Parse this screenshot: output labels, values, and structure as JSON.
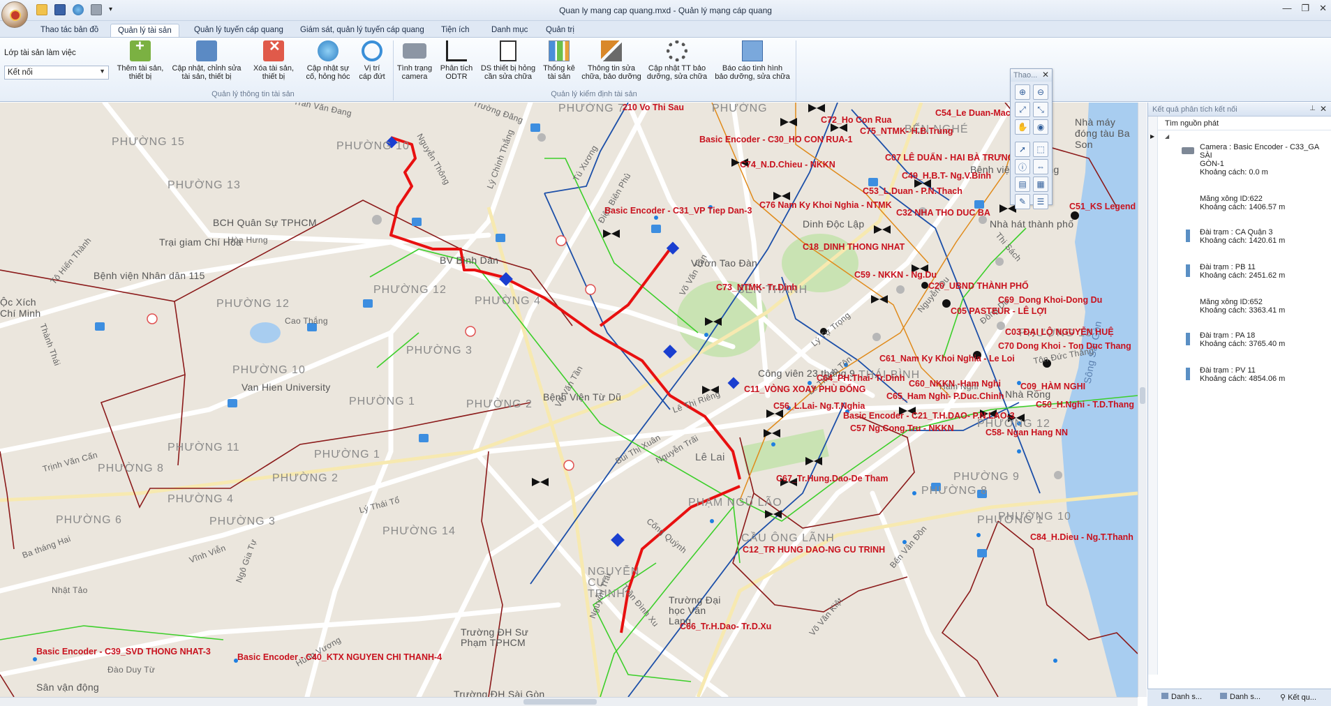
{
  "window": {
    "title": "Quan ly mang cap quang.mxd - Quản lý mạng cáp quang"
  },
  "tabs": [
    {
      "label": "Thao tác bản đồ",
      "active": false
    },
    {
      "label": "Quản lý tài sản",
      "active": true
    },
    {
      "label": "Quản lý tuyến cáp quang",
      "active": false
    },
    {
      "label": "Giám sát, quản lý tuyến cáp quang",
      "active": false
    },
    {
      "label": "Tiện ích",
      "active": false
    },
    {
      "label": "Danh mục",
      "active": false
    },
    {
      "label": "Quản trị",
      "active": false
    }
  ],
  "ribbon": {
    "layer_label": "Lớp tài sản làm việc",
    "layer_value": "Kết nối",
    "group1_label": "Quản lý thông tin tài sản",
    "group2_label": "Quản lý kiểm định tài sản",
    "buttons": [
      {
        "line1": "Thêm tài sản,",
        "line2": "thiết bị"
      },
      {
        "line1": "Cập nhật, chỉnh sửa",
        "line2": "tài sản, thiết bị"
      },
      {
        "line1": "Xóa tài sản,",
        "line2": "thiết bị"
      },
      {
        "line1": "Cập nhật sự",
        "line2": "cố, hỏng hóc"
      },
      {
        "line1": "Vị trí",
        "line2": "cáp đứt"
      },
      {
        "line1": "Tình trạng",
        "line2": "camera"
      },
      {
        "line1": "Phân tích",
        "line2": "ODTR"
      },
      {
        "line1": "DS thiết bị hỏng",
        "line2": "cần sửa chữa"
      },
      {
        "line1": "Thống kê",
        "line2": "tài sản"
      },
      {
        "line1": "Thông tin sửa",
        "line2": "chữa, bảo dưỡng"
      },
      {
        "line1": "Cập nhật TT bảo",
        "line2": "dưỡng, sửa chữa"
      },
      {
        "line1": "Báo cáo tình hình",
        "line2": "bảo dưỡng, sửa chữa"
      }
    ]
  },
  "float_toolbar": {
    "title": "Thao..."
  },
  "map": {
    "district_labels": [
      "PHƯỜNG 15",
      "PHƯỜNG 10",
      "PHƯỜNG 13",
      "PHƯỜNG 7",
      "PHƯỜNG 12",
      "PHƯỜNG 12",
      "PHƯỜNG 4",
      "PHƯỜNG 3",
      "PHƯỜNG 10",
      "PHƯỜNG 1",
      "PHƯỜNG 2",
      "PHƯỜNG 1",
      "PHƯỜNG 11",
      "PHƯỜNG 8",
      "PHƯỜNG 2",
      "PHƯỜNG 4",
      "PHƯỜNG 6",
      "PHƯỜNG 3",
      "PHƯỜNG 14",
      "PHƯỜNG 10",
      "PHƯỜNG 9",
      "PHƯỜNG 8",
      "PHƯỜNG 12",
      "PHƯỜNG 13",
      "PHƯỜNG 1",
      "BẾN THÀNH",
      "PHẠM NGŨ LÃO",
      "CẦU ÔNG LÃNH",
      "NGUYỄN CƯ TRINH",
      "THÁI BÌNH",
      "BẾN NGHÉ",
      "PHƯỜNG"
    ],
    "place_labels": [
      "BCH Quân Sự TPHCM",
      "Trại giam Chí Hòa",
      "Bệnh viện Nhân dân 115",
      "BV Bình Dân",
      "Van Hien University",
      "Vườn Tao Đàn",
      "Dinh Độc Lập",
      "Công viên 23 tháng 9",
      "Trường Đại học Văn Lang",
      "Trường ĐH Sư Phạm TPHCM",
      "Sân vận động",
      "Bệnh Viện Từ Dũ",
      "Nhà hát thành phố",
      "Nhà Rồng",
      "Nhà máy đóng tàu Ba Son",
      "Bệnh viện Nhi đồng",
      "Ộc Xích Chí Minh",
      "Trường ĐH Sài Gòn"
    ],
    "road_labels": [
      "Trần Văn Đang",
      "Trường Đăng",
      "Nguyễn Thông",
      "Lý Chính Thắng",
      "Tú Xương",
      "Điện Biên Phủ",
      "Võ Văn Tần",
      "Cao Thắng",
      "Hòa Hưng",
      "Tô Hiến Thành",
      "Thành Thái",
      "Lý Thái Tổ",
      "Ba tháng Hai",
      "Ngô Gia Tự",
      "Vĩnh Viễn",
      "Nhật Tảo",
      "Hùng Vương",
      "Đào Duy Từ",
      "Võ Văn Tần",
      "Bùi Thị Xuân",
      "Nguyễn Trãi",
      "Lê Lai",
      "Lê Thị Riêng",
      "Cống Quỳnh",
      "Trần Đình Xu",
      "Võ Văn Kiệt",
      "Bến Vân Đồn",
      "Tôn Đức Thắng",
      "Lý Tự Trọng",
      "Nguyễn Du",
      "Lê Thánh Tôn",
      "Thi Sách",
      "Sông Sài Gòn",
      "Đông Du",
      "Hàm Nghi",
      "Trịnh Văn Cấn",
      "Nguyễn Trãi"
    ],
    "red_labels": [
      "210 Vo Thi Sau",
      "C72_Ho Con Rua",
      "C54_Le Duan-Mac",
      "Basic Encoder - C30_HO CON RUA-1",
      "C75_NTMK- H.B.Trung",
      "C07 LÊ DUẨN - HAI BÀ TRƯNG",
      "C74_N.D.Chieu - NKKN",
      "C49_H.B.T- Ng.V.Binh",
      "C53_L.Duan - P.N.Thach",
      "C51_KS Legend",
      "Basic Encoder - C31_VP Tiep Dan-3",
      "C76 Nam Ky Khoi Nghia - NTMK",
      "C32 NHA THO DUC BA",
      "C18_DINH THONG NHAT",
      "C59 - NKKN - Ng.Du",
      "C20_UBND THÀNH PHỐ",
      "C73_NTMK- Tr.Dinh",
      "C69_Dong Khoi-Dong Du",
      "C05 PASTEUR - LÊ LỢI",
      "C03 ĐẠI LỘ NGUYỄN HUỆ",
      "C70 Dong Khoi - Ton Duc Thang",
      "C61_Nam Ky Khoi Nghia - Le Loi",
      "C64_PH.Thai- Tr.Dinh",
      "C60_NKKN -Ham Nghi",
      "C09_HÀM NGHI",
      "C11_VÒNG XOAY PHÙ ĐỔNG",
      "C65_Ham Nghi- P.Duc.Chinh",
      "C50_H.Nghi - T.D.Thang",
      "C56_L.Lai- Ng.T.Nghia",
      "Basic Encoder - C21_T.H.DAO- P.N.LAO-3",
      "C57 Ng.Cong.Tru - NKKN",
      "C58- Ngan Hang NN",
      "C67_Tr.Hung.Dao-De Tham",
      "C12_TR HUNG DAO-NG CU TRINH",
      "C84_H.Dieu - Ng.T.Thanh",
      "C66_Tr.H.Dao- Tr.D.Xu",
      "Basic Encoder - C39_SVD THONG NHAT-3",
      "Basic Encoder - C40_KTX NGUYEN CHI THANH-4"
    ]
  },
  "right_panel": {
    "title": "Kết quả phân tích kết nối",
    "subheader": "Tìm nguồn phát",
    "results": [
      {
        "name": "Camera : Basic Encoder - C33_GA SÀI",
        "name2": "GÒN-1",
        "distance": "Khoảng cách: 0.0 m",
        "icon": "camera-icon"
      },
      {
        "name": "Măng xông  ID:622",
        "distance": "Khoảng cách: 1406.57 m",
        "icon": "splice-icon"
      },
      {
        "name": "Đài trạm : CA Quận 3",
        "distance": "Khoảng cách: 1420.61 m",
        "icon": "antenna-icon"
      },
      {
        "name": "Đài trạm : PB 11",
        "distance": "Khoảng cách: 2451.62 m",
        "icon": "antenna-icon"
      },
      {
        "name": "Măng xông  ID:652",
        "distance": "Khoảng cách: 3363.41 m",
        "icon": "splice-icon"
      },
      {
        "name": "Đài trạm : PA 18",
        "distance": "Khoảng cách: 3765.40 m",
        "icon": "antenna-icon"
      },
      {
        "name": "Đài trạm : PV 11",
        "distance": "Khoảng cách: 4854.06 m",
        "icon": "antenna-icon"
      }
    ],
    "bottom_tabs": [
      "Danh s...",
      "Danh s...",
      "Kết qu..."
    ]
  },
  "colors": {
    "route_red": "#e81010",
    "boundary": "#8b1a1a",
    "cable_blue": "#1c4fa8",
    "cable_green": "#3ccf2a",
    "cable_orange": "#e08a1a",
    "label_red": "#c8121e"
  }
}
